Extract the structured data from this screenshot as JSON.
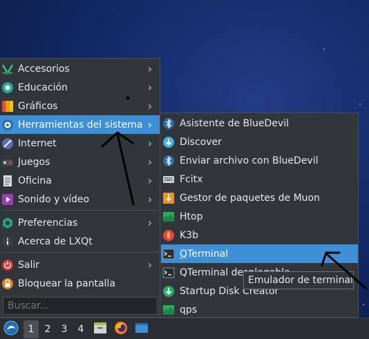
{
  "main_menu": {
    "items": [
      {
        "label": "Accesorios",
        "icon": "accessories-icon",
        "submenu": true
      },
      {
        "label": "Educación",
        "icon": "education-icon",
        "submenu": true
      },
      {
        "label": "Gráficos",
        "icon": "graphics-icon",
        "submenu": true
      },
      {
        "label": "Herramientas del sistema",
        "icon": "system-tools-icon",
        "submenu": true,
        "selected": true
      },
      {
        "label": "Internet",
        "icon": "internet-icon",
        "submenu": true
      },
      {
        "label": "Juegos",
        "icon": "games-icon",
        "submenu": true
      },
      {
        "label": "Oficina",
        "icon": "office-icon",
        "submenu": true
      },
      {
        "label": "Sonido y vídeo",
        "icon": "multimedia-icon",
        "submenu": true
      },
      {
        "label": "Preferencias",
        "icon": "preferences-icon",
        "submenu": true
      },
      {
        "label": "Acerca de LXQt",
        "icon": "info-icon",
        "submenu": false
      },
      {
        "label": "Salir",
        "icon": "power-icon",
        "submenu": true
      },
      {
        "label": "Bloquear la pantalla",
        "icon": "lock-icon",
        "submenu": false
      }
    ],
    "search_placeholder": "Buscar..."
  },
  "sub_menu": {
    "items": [
      {
        "label": "Asistente de BlueDevil",
        "icon": "bluetooth-icon"
      },
      {
        "label": "Discover",
        "icon": "discover-icon"
      },
      {
        "label": "Enviar archivo con BlueDevil",
        "icon": "bluetooth-icon"
      },
      {
        "label": "Fcitx",
        "icon": "keyboard-icon"
      },
      {
        "label": "Gestor de paquetes de Muon",
        "icon": "package-manager-icon"
      },
      {
        "label": "Htop",
        "icon": "monitor-icon"
      },
      {
        "label": "K3b",
        "icon": "k3b-icon"
      },
      {
        "label": "QTerminal",
        "icon": "terminal-icon",
        "selected": true
      },
      {
        "label": "QTerminal desplegable",
        "icon": "terminal-icon"
      },
      {
        "label": "Startup Disk Creator",
        "icon": "disk-creator-icon"
      },
      {
        "label": "qps",
        "icon": "monitor-icon"
      }
    ]
  },
  "tooltip": {
    "text": "Emulador de terminal"
  },
  "taskbar": {
    "workspaces": [
      "1",
      "2",
      "3",
      "4"
    ],
    "active_workspace": "1",
    "colors": {
      "accent": "#3d8fd8",
      "panel": "#2b2f33",
      "menu_bg": "#31363b"
    }
  }
}
